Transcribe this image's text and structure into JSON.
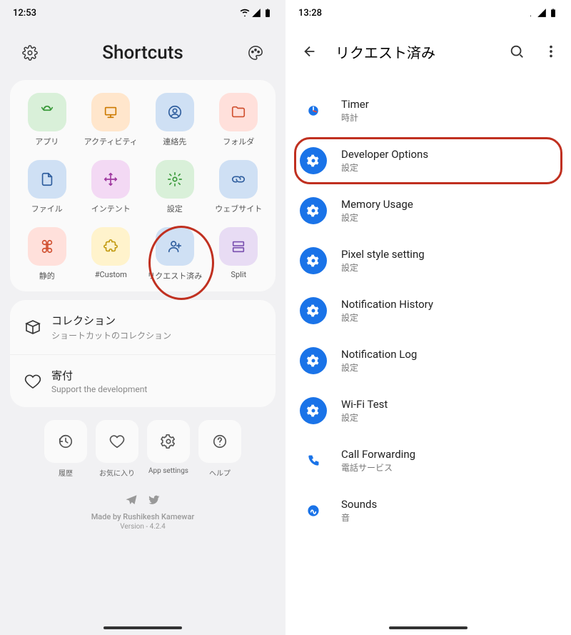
{
  "left": {
    "time": "12:53",
    "title": "Shortcuts",
    "grid": [
      {
        "label": "アプリ",
        "icon": "android",
        "bg": "#d9f0d9",
        "fg": "#3a9a3a"
      },
      {
        "label": "アクティビティ",
        "icon": "monitor",
        "bg": "#ffe6cc",
        "fg": "#cc7a00"
      },
      {
        "label": "連絡先",
        "icon": "person-circle",
        "bg": "#cfe0f4",
        "fg": "#2f5e9e"
      },
      {
        "label": "フォルダ",
        "icon": "folder",
        "bg": "#ffe0db",
        "fg": "#d05030"
      },
      {
        "label": "ファイル",
        "icon": "file",
        "bg": "#cfe0f4",
        "fg": "#2f5e9e"
      },
      {
        "label": "インテント",
        "icon": "move",
        "bg": "#f3d9f4",
        "fg": "#a03aa0"
      },
      {
        "label": "設定",
        "icon": "gear",
        "bg": "#d9f0d9",
        "fg": "#3a9a3a"
      },
      {
        "label": "ウェブサイト",
        "icon": "link",
        "bg": "#cfe0f4",
        "fg": "#2f5e9e"
      },
      {
        "label": "静的",
        "icon": "command",
        "bg": "#ffe0db",
        "fg": "#d05030"
      },
      {
        "label": "#Custom",
        "icon": "puzzle",
        "bg": "#fff3cc",
        "fg": "#c29a10"
      },
      {
        "label": "リクエスト済み",
        "icon": "person-plus",
        "bg": "#cfe0f4",
        "fg": "#2f5e9e"
      },
      {
        "label": "Split",
        "icon": "split",
        "bg": "#e8dcf4",
        "fg": "#7a50b0"
      }
    ],
    "list": [
      {
        "title": "コレクション",
        "subtitle": "ショートカットのコレクション"
      },
      {
        "title": "寄付",
        "subtitle": "Support the development"
      }
    ],
    "bottom": [
      {
        "label": "履歴",
        "icon": "history"
      },
      {
        "label": "お気に入り",
        "icon": "heart"
      },
      {
        "label": "App settings",
        "icon": "settings2"
      },
      {
        "label": "ヘルプ",
        "icon": "help"
      }
    ],
    "footer": {
      "made": "Made by Rushikesh Kamewar",
      "version": "Version - 4.2.4"
    },
    "highlight_index": 10
  },
  "right": {
    "time": "13:28",
    "title": "リクエスト済み",
    "items": [
      {
        "title": "Timer",
        "subtitle": "時計",
        "icon": "clock",
        "color": "#1a73e8"
      },
      {
        "title": "Developer Options",
        "subtitle": "設定",
        "icon": "gear-fill",
        "color": "#1a73e8"
      },
      {
        "title": "Memory Usage",
        "subtitle": "設定",
        "icon": "gear-fill",
        "color": "#1a73e8"
      },
      {
        "title": "Pixel style setting",
        "subtitle": "設定",
        "icon": "gear-fill",
        "color": "#1a73e8"
      },
      {
        "title": "Notification History",
        "subtitle": "設定",
        "icon": "gear-fill",
        "color": "#1a73e8"
      },
      {
        "title": "Notification Log",
        "subtitle": "設定",
        "icon": "gear-fill",
        "color": "#1a73e8"
      },
      {
        "title": "Wi-Fi Test",
        "subtitle": "設定",
        "icon": "gear-fill",
        "color": "#1a73e8"
      },
      {
        "title": "Call Forwarding",
        "subtitle": "電話サービス",
        "icon": "phone",
        "color": "#1a73e8"
      },
      {
        "title": "Sounds",
        "subtitle": "音",
        "icon": "sounds",
        "color": "#1a73e8"
      }
    ],
    "highlight_index": 1
  }
}
